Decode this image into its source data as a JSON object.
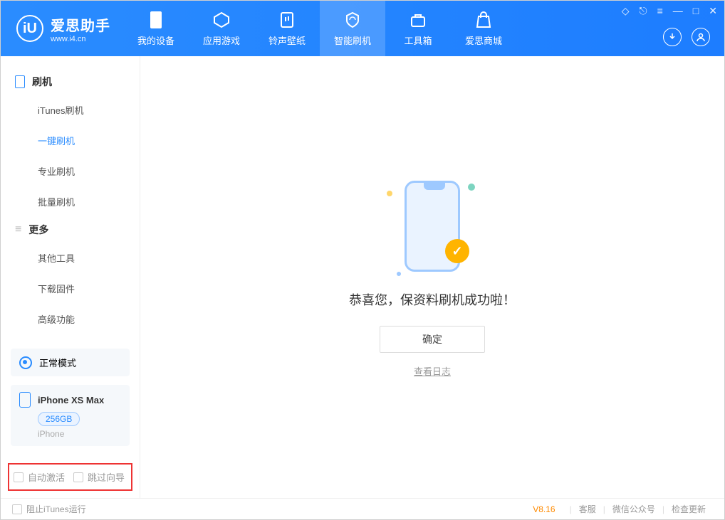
{
  "header": {
    "logo_title": "爱思助手",
    "logo_sub": "www.i4.cn",
    "nav": [
      {
        "label": "我的设备",
        "icon": "device-icon"
      },
      {
        "label": "应用游戏",
        "icon": "apps-icon"
      },
      {
        "label": "铃声壁纸",
        "icon": "ringtone-icon"
      },
      {
        "label": "智能刷机",
        "icon": "flash-icon",
        "active": true
      },
      {
        "label": "工具箱",
        "icon": "toolbox-icon"
      },
      {
        "label": "爱思商城",
        "icon": "store-icon"
      }
    ]
  },
  "sidebar": {
    "group1_title": "刷机",
    "group1_items": [
      "iTunes刷机",
      "一键刷机",
      "专业刷机",
      "批量刷机"
    ],
    "group1_active_index": 1,
    "group2_title": "更多",
    "group2_items": [
      "其他工具",
      "下载固件",
      "高级功能"
    ],
    "mode_label": "正常模式",
    "device": {
      "name": "iPhone XS Max",
      "storage": "256GB",
      "type": "iPhone"
    },
    "check_auto_activate": "自动激活",
    "check_skip_guide": "跳过向导"
  },
  "main": {
    "success_msg": "恭喜您，保资料刷机成功啦！",
    "ok_label": "确定",
    "view_log": "查看日志"
  },
  "footer": {
    "block_itunes": "阻止iTunes运行",
    "version": "V8.16",
    "links": [
      "客服",
      "微信公众号",
      "检查更新"
    ]
  }
}
